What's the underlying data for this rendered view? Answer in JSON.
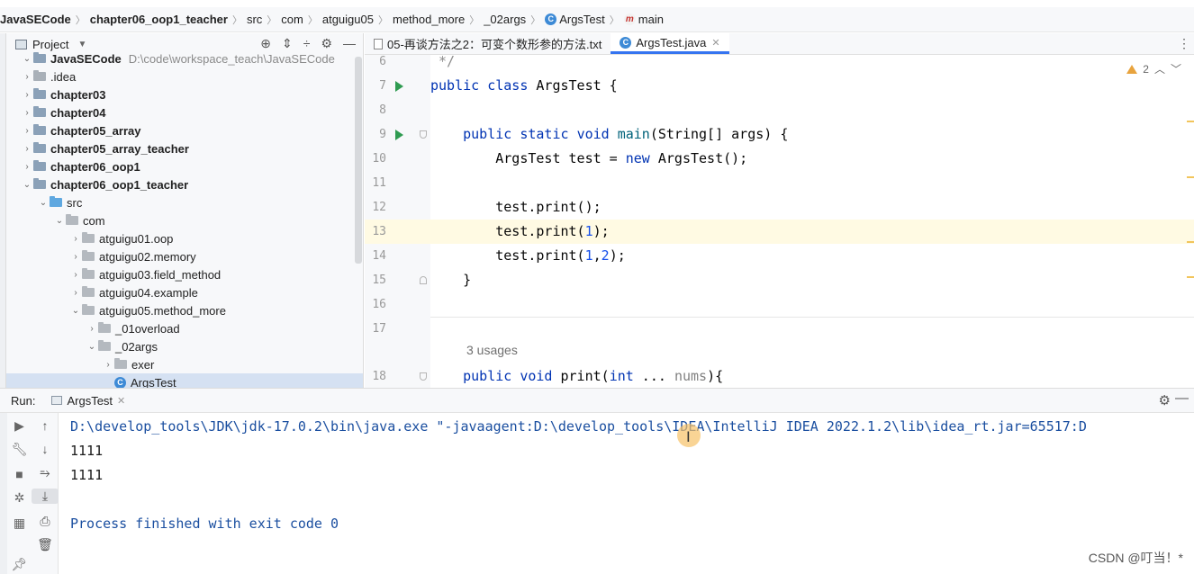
{
  "breadcrumb": {
    "items": [
      "JavaSECode",
      "chapter06_oop1_teacher",
      "src",
      "com",
      "atguigu05",
      "method_more",
      "_02args",
      "ArgsTest",
      "main"
    ]
  },
  "project": {
    "title": "Project",
    "root": {
      "name": "JavaSECode",
      "path": "D:\\code\\workspace_teach\\JavaSECode"
    },
    "items": [
      {
        "label": ".idea",
        "level": 1,
        "icon": "folder-icon",
        "bold": false,
        "expanded": false
      },
      {
        "label": "chapter03",
        "level": 1,
        "icon": "module-icon",
        "bold": true,
        "expanded": false
      },
      {
        "label": "chapter04",
        "level": 1,
        "icon": "module-icon",
        "bold": true,
        "expanded": false
      },
      {
        "label": "chapter05_array",
        "level": 1,
        "icon": "module-icon",
        "bold": true,
        "expanded": false
      },
      {
        "label": "chapter05_array_teacher",
        "level": 1,
        "icon": "module-icon",
        "bold": true,
        "expanded": false
      },
      {
        "label": "chapter06_oop1",
        "level": 1,
        "icon": "module-icon",
        "bold": true,
        "expanded": false
      },
      {
        "label": "chapter06_oop1_teacher",
        "level": 1,
        "icon": "module-icon",
        "bold": true,
        "expanded": true
      },
      {
        "label": "src",
        "level": 2,
        "icon": "source-folder-icon",
        "bold": false,
        "expanded": true
      },
      {
        "label": "com",
        "level": 3,
        "icon": "package-icon",
        "bold": false,
        "expanded": true
      },
      {
        "label": "atguigu01.oop",
        "level": 4,
        "icon": "package-icon",
        "bold": false,
        "expanded": false
      },
      {
        "label": "atguigu02.memory",
        "level": 4,
        "icon": "package-icon",
        "bold": false,
        "expanded": false
      },
      {
        "label": "atguigu03.field_method",
        "level": 4,
        "icon": "package-icon",
        "bold": false,
        "expanded": false
      },
      {
        "label": "atguigu04.example",
        "level": 4,
        "icon": "package-icon",
        "bold": false,
        "expanded": false
      },
      {
        "label": "atguigu05.method_more",
        "level": 4,
        "icon": "package-icon",
        "bold": false,
        "expanded": true
      },
      {
        "label": "_01overload",
        "level": 5,
        "icon": "package-icon",
        "bold": false,
        "expanded": false
      },
      {
        "label": "_02args",
        "level": 5,
        "icon": "package-icon",
        "bold": false,
        "expanded": true
      },
      {
        "label": "exer",
        "level": 6,
        "icon": "package-icon",
        "bold": false,
        "expanded": false
      },
      {
        "label": "ArgsTest",
        "level": 6,
        "icon": "class-icon",
        "bold": false,
        "leaf": true,
        "selected": true
      }
    ]
  },
  "editor": {
    "tabs": [
      {
        "label": "05-再谈方法之2：可变个数形参的方法.txt",
        "active": false,
        "icon": "text-file-icon"
      },
      {
        "label": "ArgsTest.java",
        "active": true,
        "icon": "class-icon"
      }
    ],
    "inspection": {
      "warnings": "2"
    },
    "lines": [
      {
        "num": "6",
        "code": " */",
        "kind": "comment"
      },
      {
        "num": "7",
        "code": "public class ArgsTest {",
        "run": true
      },
      {
        "num": "8",
        "code": ""
      },
      {
        "num": "9",
        "code": "    public static void main(String[] args) {",
        "run": true,
        "fold": "down"
      },
      {
        "num": "10",
        "code": "        ArgsTest test = new ArgsTest();"
      },
      {
        "num": "11",
        "code": ""
      },
      {
        "num": "12",
        "code": "        test.print();"
      },
      {
        "num": "13",
        "code": "        test.print(1);",
        "highlight": true
      },
      {
        "num": "14",
        "code": "        test.print(1,2);"
      },
      {
        "num": "15",
        "code": "    }",
        "fold": "up"
      },
      {
        "num": "16",
        "code": ""
      },
      {
        "num": "17",
        "code": ""
      },
      {
        "num": "18",
        "code": "    public void print(int ... nums){",
        "fold": "down"
      }
    ],
    "usages": "3 usages"
  },
  "run": {
    "label": "Run:",
    "tab": "ArgsTest",
    "console": [
      {
        "text": "D:\\develop_tools\\JDK\\jdk-17.0.2\\bin\\java.exe \"-javaagent:D:\\develop_tools\\IDEA\\IntelliJ IDEA 2022.1.2\\lib\\idea_rt.jar=65517:D",
        "kind": "cmd"
      },
      {
        "text": "1111",
        "kind": "out"
      },
      {
        "text": "1111",
        "kind": "out"
      },
      {
        "text": "",
        "kind": "out"
      },
      {
        "text": "Process finished with exit code 0",
        "kind": "proc"
      }
    ]
  },
  "watermark": "CSDN @叮当！*"
}
